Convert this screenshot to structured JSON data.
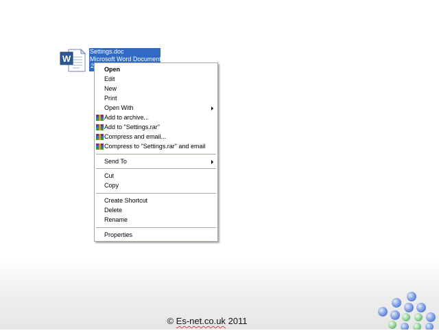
{
  "file": {
    "name": "Settings.doc",
    "type": "Microsoft Word Document",
    "size_truncated": "2",
    "icon": "word-document-icon"
  },
  "context_menu": {
    "items": [
      {
        "label": "Open",
        "bold": true
      },
      {
        "label": "Edit"
      },
      {
        "label": "New"
      },
      {
        "label": "Print"
      },
      {
        "label": "Open With",
        "submenu": true
      },
      {
        "label": "Add to archive...",
        "icon": "winrar-icon"
      },
      {
        "label": "Add to \"Settings.rar\"",
        "icon": "winrar-icon"
      },
      {
        "label": "Compress and email...",
        "icon": "winrar-icon"
      },
      {
        "label": "Compress to \"Settings.rar\" and email",
        "icon": "winrar-icon"
      },
      {
        "label": "Send To",
        "submenu": true
      },
      {
        "label": "Cut"
      },
      {
        "label": "Copy"
      },
      {
        "label": "Create Shortcut"
      },
      {
        "label": "Delete"
      },
      {
        "label": "Rename"
      },
      {
        "label": "Properties"
      }
    ]
  },
  "footer": {
    "copyright_symbol": "©",
    "site": "Es-net.co.uk",
    "year": "2011"
  },
  "colors": {
    "selection": "#316ac5",
    "menu_border": "#aca899",
    "ball_blue": "#7f9fe0",
    "ball_green": "#9fd4a0"
  }
}
